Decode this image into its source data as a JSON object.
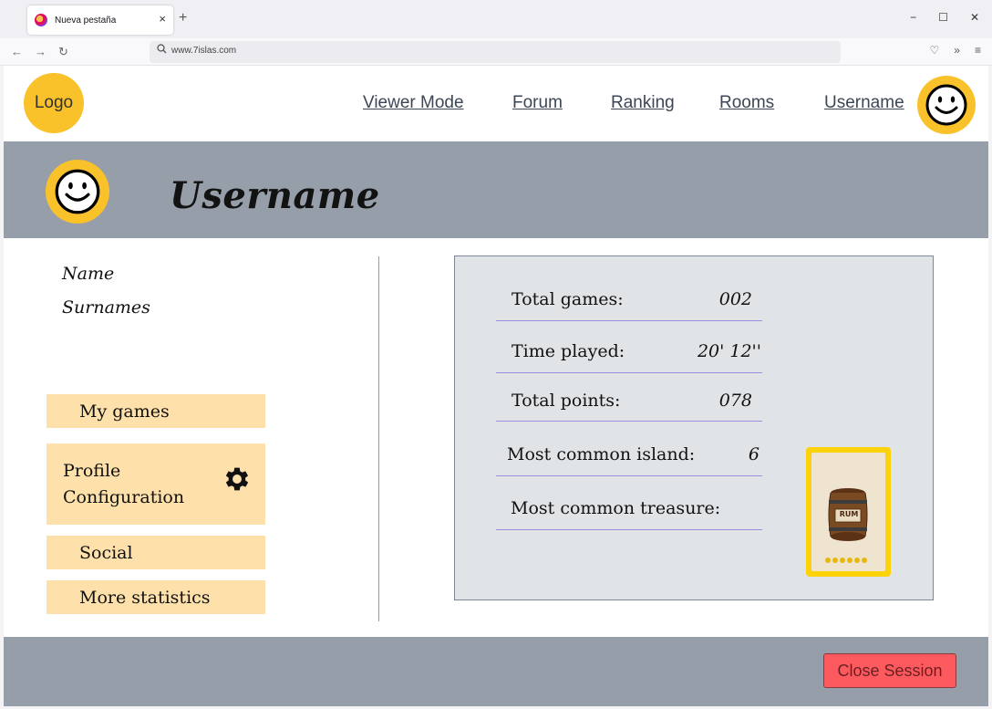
{
  "browser": {
    "tab_title": "Nueva pestaña",
    "tab_close": "×",
    "new_tab": "+",
    "url": "www.7islas.com",
    "back": "←",
    "forward": "→",
    "reload": "↻",
    "minimize": "−",
    "maximize": "☐",
    "close": "✕",
    "pocket": "♡",
    "overflow": "»",
    "menu": "≡"
  },
  "site": {
    "logo": "Logo",
    "nav": {
      "viewer_mode": "Viewer Mode",
      "forum": "Forum",
      "ranking": "Ranking",
      "rooms": "Rooms",
      "username": "Username"
    },
    "profile": {
      "username": "Username",
      "name_label": "Name",
      "surnames_label": "Surnames"
    },
    "sidebar": {
      "my_games": "My games",
      "profile_configuration": "Profile Configuration",
      "social": "Social",
      "more_statistics": "More statistics"
    },
    "stats": {
      "total_games_label": "Total games:",
      "total_games_value": "002",
      "time_played_label": "Time played:",
      "time_played_value": "20' 12''",
      "total_points_label": "Total points:",
      "total_points_value": "078",
      "common_island_label": "Most common island:",
      "common_island_value": "6",
      "common_treasure_label": "Most common treasure:",
      "treasure_text": "RUM"
    },
    "footer": {
      "close_session": "Close Session"
    }
  },
  "colors": {
    "accent_yellow": "#f9c22b",
    "banner_gray": "#969eaa",
    "sidebar_button": "#fde0aa",
    "stats_bg": "#e1e4e7",
    "divider": "#9b8ee0",
    "close_button": "#fc5a5f"
  }
}
